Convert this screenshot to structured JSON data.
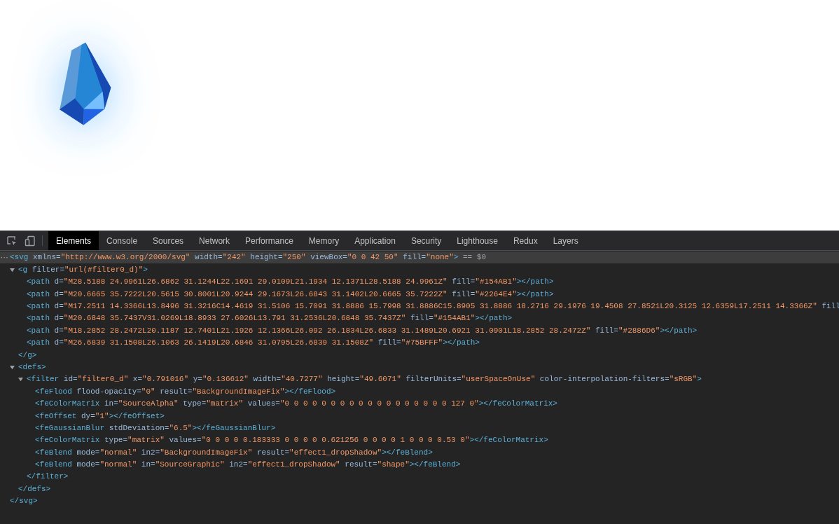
{
  "devtools": {
    "tabs": [
      {
        "label": "Elements",
        "selected": true
      },
      {
        "label": "Console",
        "selected": false
      },
      {
        "label": "Sources",
        "selected": false
      },
      {
        "label": "Network",
        "selected": false
      },
      {
        "label": "Performance",
        "selected": false
      },
      {
        "label": "Memory",
        "selected": false
      },
      {
        "label": "Application",
        "selected": false
      },
      {
        "label": "Security",
        "selected": false
      },
      {
        "label": "Lighthouse",
        "selected": false
      },
      {
        "label": "Redux",
        "selected": false
      },
      {
        "label": "Layers",
        "selected": false
      }
    ],
    "dom_tree": [
      {
        "marker": "···",
        "selected": true,
        "open": [
          {
            "kind": "tag",
            "text": "<svg"
          },
          {
            "kind": "attr",
            "text": " xmlns="
          },
          {
            "kind": "value",
            "text": "\"http://www.w3.org/2000/svg\""
          },
          {
            "kind": "attr",
            "text": " width="
          },
          {
            "kind": "value",
            "text": "\"242\""
          },
          {
            "kind": "attr",
            "text": " height="
          },
          {
            "kind": "value",
            "text": "\"250\""
          },
          {
            "kind": "attr",
            "text": " viewBox="
          },
          {
            "kind": "value",
            "text": "\"0 0 42 50\""
          },
          {
            "kind": "attr",
            "text": " fill="
          },
          {
            "kind": "value",
            "text": "\"none\""
          },
          {
            "kind": "tag",
            "text": ">"
          },
          {
            "kind": "note",
            "text": " == $0"
          }
        ],
        "close": [
          {
            "kind": "tag",
            "text": "</svg>"
          }
        ],
        "children": [
          {
            "selected": false,
            "expanded": true,
            "open": [
              {
                "kind": "tag",
                "text": "<g"
              },
              {
                "kind": "attr",
                "text": " filter="
              },
              {
                "kind": "value",
                "text": "\"url(#filter0_d)\""
              },
              {
                "kind": "tag",
                "text": ">"
              }
            ],
            "close": [
              {
                "kind": "tag",
                "text": "</g>"
              }
            ],
            "children": [
              {
                "selected": false,
                "open": [
                  {
                    "kind": "tag",
                    "text": "<path"
                  },
                  {
                    "kind": "attr",
                    "text": " d="
                  },
                  {
                    "kind": "value",
                    "text": "\"M28.5188 24.9961L26.6862 31.1244L22.1691 29.0109L21.1934 12.1371L28.5188 24.9961Z\""
                  },
                  {
                    "kind": "attr",
                    "text": " fill="
                  },
                  {
                    "kind": "value",
                    "text": "\"#154AB1\""
                  },
                  {
                    "kind": "tag",
                    "text": "></path>"
                  }
                ]
              },
              {
                "selected": false,
                "open": [
                  {
                    "kind": "tag",
                    "text": "<path"
                  },
                  {
                    "kind": "attr",
                    "text": " d="
                  },
                  {
                    "kind": "value",
                    "text": "\"M20.6665 35.7222L20.5615 30.8001L20.9244 29.1673L26.6843 31.1402L20.6665 35.7222Z\""
                  },
                  {
                    "kind": "attr",
                    "text": " fill="
                  },
                  {
                    "kind": "value",
                    "text": "\"#2264E4\""
                  },
                  {
                    "kind": "tag",
                    "text": "></path>"
                  }
                ]
              },
              {
                "selected": false,
                "open": [
                  {
                    "kind": "tag",
                    "text": "<path"
                  },
                  {
                    "kind": "attr",
                    "text": " d="
                  },
                  {
                    "kind": "value",
                    "text": "\"M17.2511 14.3366L13.8496 31.3216C14.4619 31.5106 15.7091 31.8886 15.7998 31.8886C15.8905 31.8886 18.2716 29.1976 19.4508 27.8521L20.3125 12.6359L17.2511 14.3366Z\""
                  },
                  {
                    "kind": "attr",
                    "text": " fill"
                  }
                ]
              },
              {
                "selected": false,
                "open": [
                  {
                    "kind": "tag",
                    "text": "<path"
                  },
                  {
                    "kind": "attr",
                    "text": " d="
                  },
                  {
                    "kind": "value",
                    "text": "\"M20.6848 35.7437V31.0269L18.8933 27.6026L13.791 31.2536L20.6848 35.7437Z\""
                  },
                  {
                    "kind": "attr",
                    "text": " fill="
                  },
                  {
                    "kind": "value",
                    "text": "\"#154AB1\""
                  },
                  {
                    "kind": "tag",
                    "text": "></path>"
                  }
                ]
              },
              {
                "selected": false,
                "open": [
                  {
                    "kind": "tag",
                    "text": "<path"
                  },
                  {
                    "kind": "attr",
                    "text": " d="
                  },
                  {
                    "kind": "value",
                    "text": "\"M18.2852 28.2472L20.1187 12.7401L21.1926 12.1366L26.092 26.1834L26.6833 31.1489L20.6921 31.0901L18.2852 28.2472Z\""
                  },
                  {
                    "kind": "attr",
                    "text": " fill="
                  },
                  {
                    "kind": "value",
                    "text": "\"#2886D6\""
                  },
                  {
                    "kind": "tag",
                    "text": "></path>"
                  }
                ]
              },
              {
                "selected": false,
                "open": [
                  {
                    "kind": "tag",
                    "text": "<path"
                  },
                  {
                    "kind": "attr",
                    "text": " d="
                  },
                  {
                    "kind": "value",
                    "text": "\"M26.6839 31.1508L26.1063 26.1419L20.6846 31.0795L26.6839 31.1508Z\""
                  },
                  {
                    "kind": "attr",
                    "text": " fill="
                  },
                  {
                    "kind": "value",
                    "text": "\"#75BFFF\""
                  },
                  {
                    "kind": "tag",
                    "text": "></path>"
                  }
                ]
              }
            ]
          },
          {
            "selected": false,
            "expanded": true,
            "open": [
              {
                "kind": "tag",
                "text": "<defs>"
              }
            ],
            "close": [
              {
                "kind": "tag",
                "text": "</defs>"
              }
            ],
            "children": [
              {
                "selected": false,
                "expanded": true,
                "open": [
                  {
                    "kind": "tag",
                    "text": "<filter"
                  },
                  {
                    "kind": "attr",
                    "text": " id="
                  },
                  {
                    "kind": "value",
                    "text": "\"filter0_d\""
                  },
                  {
                    "kind": "attr",
                    "text": " x="
                  },
                  {
                    "kind": "value",
                    "text": "\"0.791016\""
                  },
                  {
                    "kind": "attr",
                    "text": " y="
                  },
                  {
                    "kind": "value",
                    "text": "\"0.136612\""
                  },
                  {
                    "kind": "attr",
                    "text": " width="
                  },
                  {
                    "kind": "value",
                    "text": "\"40.7277\""
                  },
                  {
                    "kind": "attr",
                    "text": " height="
                  },
                  {
                    "kind": "value",
                    "text": "\"49.6071\""
                  },
                  {
                    "kind": "attr",
                    "text": " filterUnits="
                  },
                  {
                    "kind": "value",
                    "text": "\"userSpaceOnUse\""
                  },
                  {
                    "kind": "attr",
                    "text": " color-interpolation-filters="
                  },
                  {
                    "kind": "value",
                    "text": "\"sRGB\""
                  },
                  {
                    "kind": "tag",
                    "text": ">"
                  }
                ],
                "close": [
                  {
                    "kind": "tag",
                    "text": "</filter>"
                  }
                ],
                "children": [
                  {
                    "selected": false,
                    "open": [
                      {
                        "kind": "tag",
                        "text": "<feFlood"
                      },
                      {
                        "kind": "attr",
                        "text": " flood-opacity="
                      },
                      {
                        "kind": "value",
                        "text": "\"0\""
                      },
                      {
                        "kind": "attr",
                        "text": " result="
                      },
                      {
                        "kind": "value",
                        "text": "\"BackgroundImageFix\""
                      },
                      {
                        "kind": "tag",
                        "text": "></feFlood>"
                      }
                    ]
                  },
                  {
                    "selected": false,
                    "open": [
                      {
                        "kind": "tag",
                        "text": "<feColorMatrix"
                      },
                      {
                        "kind": "attr",
                        "text": " in="
                      },
                      {
                        "kind": "value",
                        "text": "\"SourceAlpha\""
                      },
                      {
                        "kind": "attr",
                        "text": " type="
                      },
                      {
                        "kind": "value",
                        "text": "\"matrix\""
                      },
                      {
                        "kind": "attr",
                        "text": " values="
                      },
                      {
                        "kind": "value",
                        "text": "\"0 0 0 0 0 0 0 0 0 0 0 0 0 0 0 0 0 0 127 0\""
                      },
                      {
                        "kind": "tag",
                        "text": "></feColorMatrix>"
                      }
                    ]
                  },
                  {
                    "selected": false,
                    "open": [
                      {
                        "kind": "tag",
                        "text": "<feOffset"
                      },
                      {
                        "kind": "attr",
                        "text": " dy="
                      },
                      {
                        "kind": "value",
                        "text": "\"1\""
                      },
                      {
                        "kind": "tag",
                        "text": "></feOffset>"
                      }
                    ]
                  },
                  {
                    "selected": false,
                    "open": [
                      {
                        "kind": "tag",
                        "text": "<feGaussianBlur"
                      },
                      {
                        "kind": "attr",
                        "text": " stdDeviation="
                      },
                      {
                        "kind": "value",
                        "text": "\"6.5\""
                      },
                      {
                        "kind": "tag",
                        "text": "></feGaussianBlur>"
                      }
                    ]
                  },
                  {
                    "selected": false,
                    "open": [
                      {
                        "kind": "tag",
                        "text": "<feColorMatrix"
                      },
                      {
                        "kind": "attr",
                        "text": " type="
                      },
                      {
                        "kind": "value",
                        "text": "\"matrix\""
                      },
                      {
                        "kind": "attr",
                        "text": " values="
                      },
                      {
                        "kind": "value",
                        "text": "\"0 0 0 0 0.183333 0 0 0 0 0.621256 0 0 0 0 1 0 0 0 0.53 0\""
                      },
                      {
                        "kind": "tag",
                        "text": "></feColorMatrix>"
                      }
                    ]
                  },
                  {
                    "selected": false,
                    "open": [
                      {
                        "kind": "tag",
                        "text": "<feBlend"
                      },
                      {
                        "kind": "attr",
                        "text": " mode="
                      },
                      {
                        "kind": "value",
                        "text": "\"normal\""
                      },
                      {
                        "kind": "attr",
                        "text": " in2="
                      },
                      {
                        "kind": "value",
                        "text": "\"BackgroundImageFix\""
                      },
                      {
                        "kind": "attr",
                        "text": " result="
                      },
                      {
                        "kind": "value",
                        "text": "\"effect1_dropShadow\""
                      },
                      {
                        "kind": "tag",
                        "text": "></feBlend>"
                      }
                    ]
                  },
                  {
                    "selected": false,
                    "open": [
                      {
                        "kind": "tag",
                        "text": "<feBlend"
                      },
                      {
                        "kind": "attr",
                        "text": " mode="
                      },
                      {
                        "kind": "value",
                        "text": "\"normal\""
                      },
                      {
                        "kind": "attr",
                        "text": " in="
                      },
                      {
                        "kind": "value",
                        "text": "\"SourceGraphic\""
                      },
                      {
                        "kind": "attr",
                        "text": " in2="
                      },
                      {
                        "kind": "value",
                        "text": "\"effect1_dropShadow\""
                      },
                      {
                        "kind": "attr",
                        "text": " result="
                      },
                      {
                        "kind": "value",
                        "text": "\"shape\""
                      },
                      {
                        "kind": "tag",
                        "text": "></feBlend>"
                      }
                    ]
                  }
                ]
              }
            ]
          }
        ]
      }
    ]
  }
}
